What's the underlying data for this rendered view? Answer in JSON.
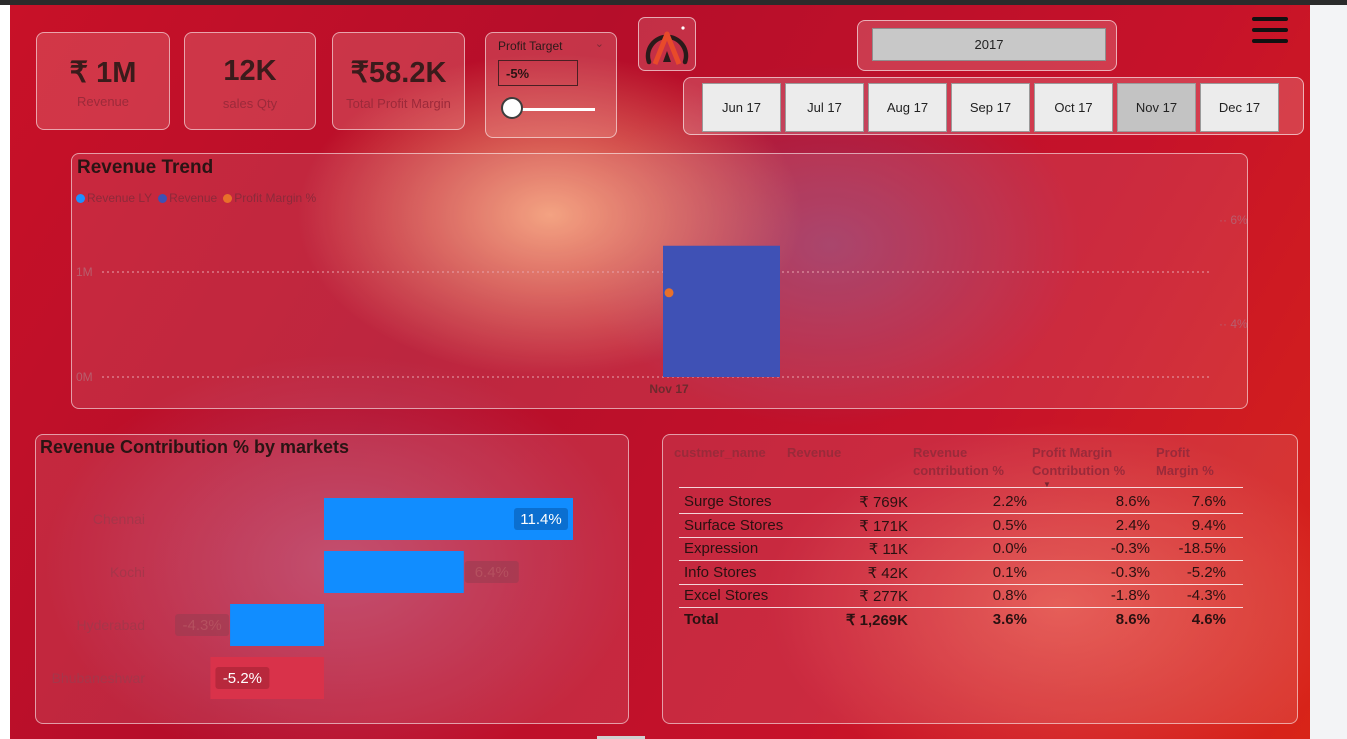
{
  "kpis": [
    {
      "value": "₹ 1M",
      "label": "Revenue"
    },
    {
      "value": "12K",
      "label": "sales Qty"
    },
    {
      "value": "₹58.2K",
      "label": "Total Profit Margin"
    }
  ],
  "profit_target": {
    "title": "Profit Target",
    "value": "-5%",
    "slider_position": 0.0
  },
  "logo_icon": "brand-logo-icon",
  "year_filter": {
    "selected": "2017"
  },
  "month_filter": {
    "months": [
      "Jun 17",
      "Jul 17",
      "Aug 17",
      "Sep 17",
      "Oct 17",
      "Nov 17",
      "Dec 17"
    ],
    "selected": "Nov 17"
  },
  "menu_icon": "hamburger-menu-icon",
  "revenue_trend": {
    "title": "Revenue Trend",
    "legend": [
      {
        "name": "Revenue LY",
        "color": "#1e90ff"
      },
      {
        "name": "Revenue",
        "color": "#3f51b5"
      },
      {
        "name": "Profit Margin %",
        "color": "#e8702a"
      }
    ]
  },
  "contribution": {
    "title": "Revenue Contribution % by markets"
  },
  "table": {
    "headers": [
      "custmer_name",
      "Revenue",
      "Revenue contribution %",
      "Profit Margin Contribution %",
      "Profit Margin %"
    ],
    "rows": [
      [
        "Surge Stores",
        "₹ 769K",
        "2.2%",
        "8.6%",
        "7.6%"
      ],
      [
        "Surface Stores",
        "₹ 171K",
        "0.5%",
        "2.4%",
        "9.4%"
      ],
      [
        "Expression",
        "₹ 11K",
        "0.0%",
        "-0.3%",
        "-18.5%"
      ],
      [
        "Info Stores",
        "₹ 42K",
        "0.1%",
        "-0.3%",
        "-5.2%"
      ],
      [
        "Excel Stores",
        "₹ 277K",
        "0.8%",
        "-1.8%",
        "-4.3%"
      ]
    ],
    "total": [
      "Total",
      "₹ 1,269K",
      "3.6%",
      "8.6%",
      "4.6%"
    ]
  },
  "chart_data": [
    {
      "type": "bar",
      "title": "Revenue Trend",
      "categories": [
        "Nov 17"
      ],
      "series": [
        {
          "name": "Revenue LY",
          "values": [
            null
          ],
          "color": "#1e90ff"
        },
        {
          "name": "Revenue",
          "values": [
            1250000
          ],
          "color": "#3f51b5"
        },
        {
          "name": "Profit Margin %",
          "values": [
            4.6
          ],
          "color": "#e8702a",
          "axis": "right"
        }
      ],
      "y_ticks": [
        "0M",
        "1M"
      ],
      "y2_ticks": [
        "4%",
        "6%"
      ],
      "ylim": [
        0,
        1250000
      ],
      "y2lim": [
        2,
        7
      ],
      "grid": true,
      "legend": "top-left"
    },
    {
      "type": "bar",
      "orientation": "horizontal",
      "title": "Revenue Contribution % by markets",
      "categories": [
        "Chennai",
        "Kochi",
        "Hyderabad",
        "Bhubaneshwar"
      ],
      "values": [
        11.4,
        6.4,
        -4.3,
        -5.2
      ],
      "labels": [
        "11.4%",
        "6.4%",
        "-4.3%",
        "-5.2%"
      ],
      "colors": [
        "#118dff",
        "#118dff",
        "#118dff",
        "#d9324a"
      ]
    }
  ]
}
